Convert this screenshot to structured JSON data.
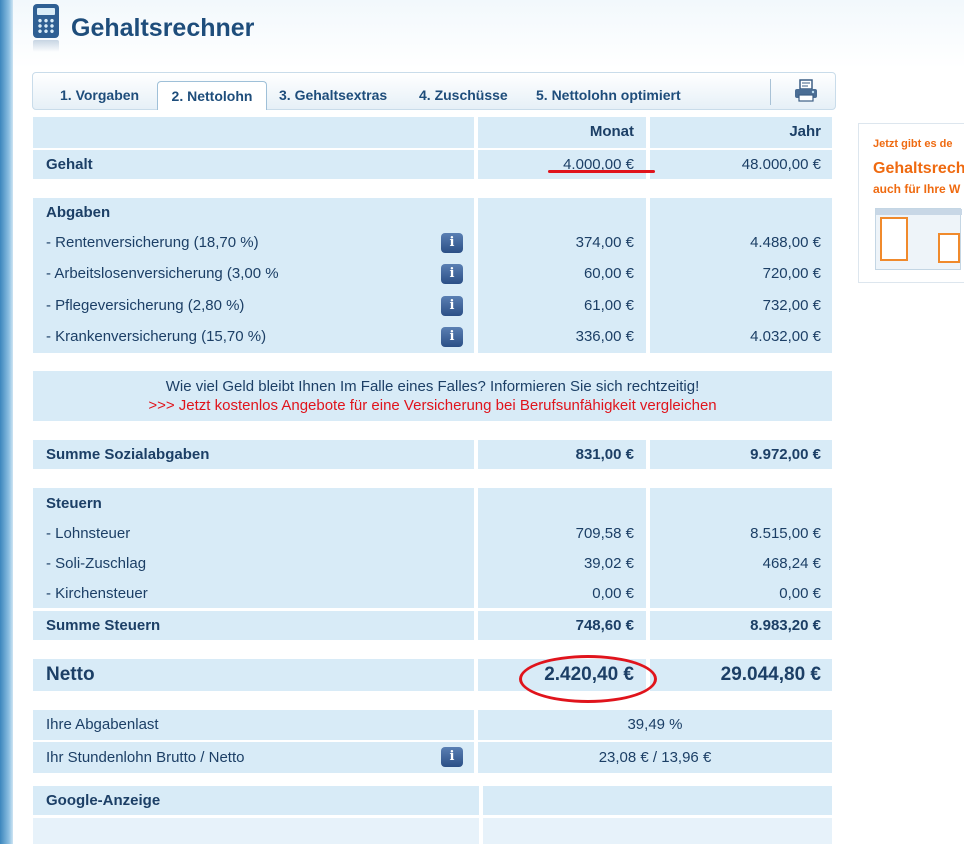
{
  "app": {
    "title": "Gehaltsrechner"
  },
  "tabs": [
    {
      "label": "1. Vorgaben"
    },
    {
      "label": "2. Nettolohn",
      "active": true
    },
    {
      "label": "3. Gehaltsextras"
    },
    {
      "label": "4. Zuschüsse"
    },
    {
      "label": "5. Nettolohn optimiert"
    }
  ],
  "table": {
    "col_month": "Monat",
    "col_year": "Jahr",
    "gehalt": {
      "label": "Gehalt",
      "month": "4.000,00 €",
      "year": "48.000,00 €"
    },
    "abgaben": {
      "heading": "Abgaben",
      "items": [
        {
          "label": "- Rentenversicherung (18,70 %)",
          "month": "374,00 €",
          "year": "4.488,00 €"
        },
        {
          "label": "- Arbeitslosenversicherung (3,00 %",
          "month": "60,00 €",
          "year": "720,00 €"
        },
        {
          "label": "- Pflegeversicherung (2,80 %)",
          "month": "61,00 €",
          "year": "732,00 €"
        },
        {
          "label": "- Krankenversicherung (15,70 %)",
          "month": "336,00 €",
          "year": "4.032,00 €"
        }
      ]
    },
    "banner": {
      "line1": "Wie viel Geld bleibt Ihnen Im Falle eines Falles? Informieren Sie sich rechtzeitig!",
      "line2": ">>> Jetzt kostenlos Angebote für eine Versicherung bei Berufsunfähigkeit vergleichen"
    },
    "summe_sozial": {
      "label": "Summe Sozialabgaben",
      "month": "831,00 €",
      "year": "9.972,00 €"
    },
    "steuern": {
      "heading": "Steuern",
      "items": [
        {
          "label": "- Lohnsteuer",
          "month": "709,58 €",
          "year": "8.515,00 €"
        },
        {
          "label": "- Soli-Zuschlag",
          "month": "39,02 €",
          "year": "468,24 €"
        },
        {
          "label": "- Kirchensteuer",
          "month": "0,00 €",
          "year": "0,00 €"
        }
      ]
    },
    "summe_steuern": {
      "label": "Summe Steuern",
      "month": "748,60 €",
      "year": "8.983,20 €"
    },
    "netto": {
      "label": "Netto",
      "month": "2.420,40 €",
      "year": "29.044,80 €"
    },
    "abgabenlast": {
      "label": "Ihre Abgabenlast",
      "value": "39,49 %"
    },
    "stundenlohn": {
      "label": "Ihr Stundenlohn Brutto / Netto",
      "value": "23,08 € / 13,96 €"
    },
    "google": {
      "label": "Google-Anzeige"
    },
    "info_glyph": "i"
  },
  "ad": {
    "line1": "Jetzt gibt es de",
    "line2": "Gehaltsrech",
    "line3": "auch für Ihre W"
  },
  "colors": {
    "accent": "#1e4d7b",
    "cell_bg": "#d8ebf7",
    "alert_red": "#e0141c",
    "ad_orange": "#ef6a10"
  }
}
